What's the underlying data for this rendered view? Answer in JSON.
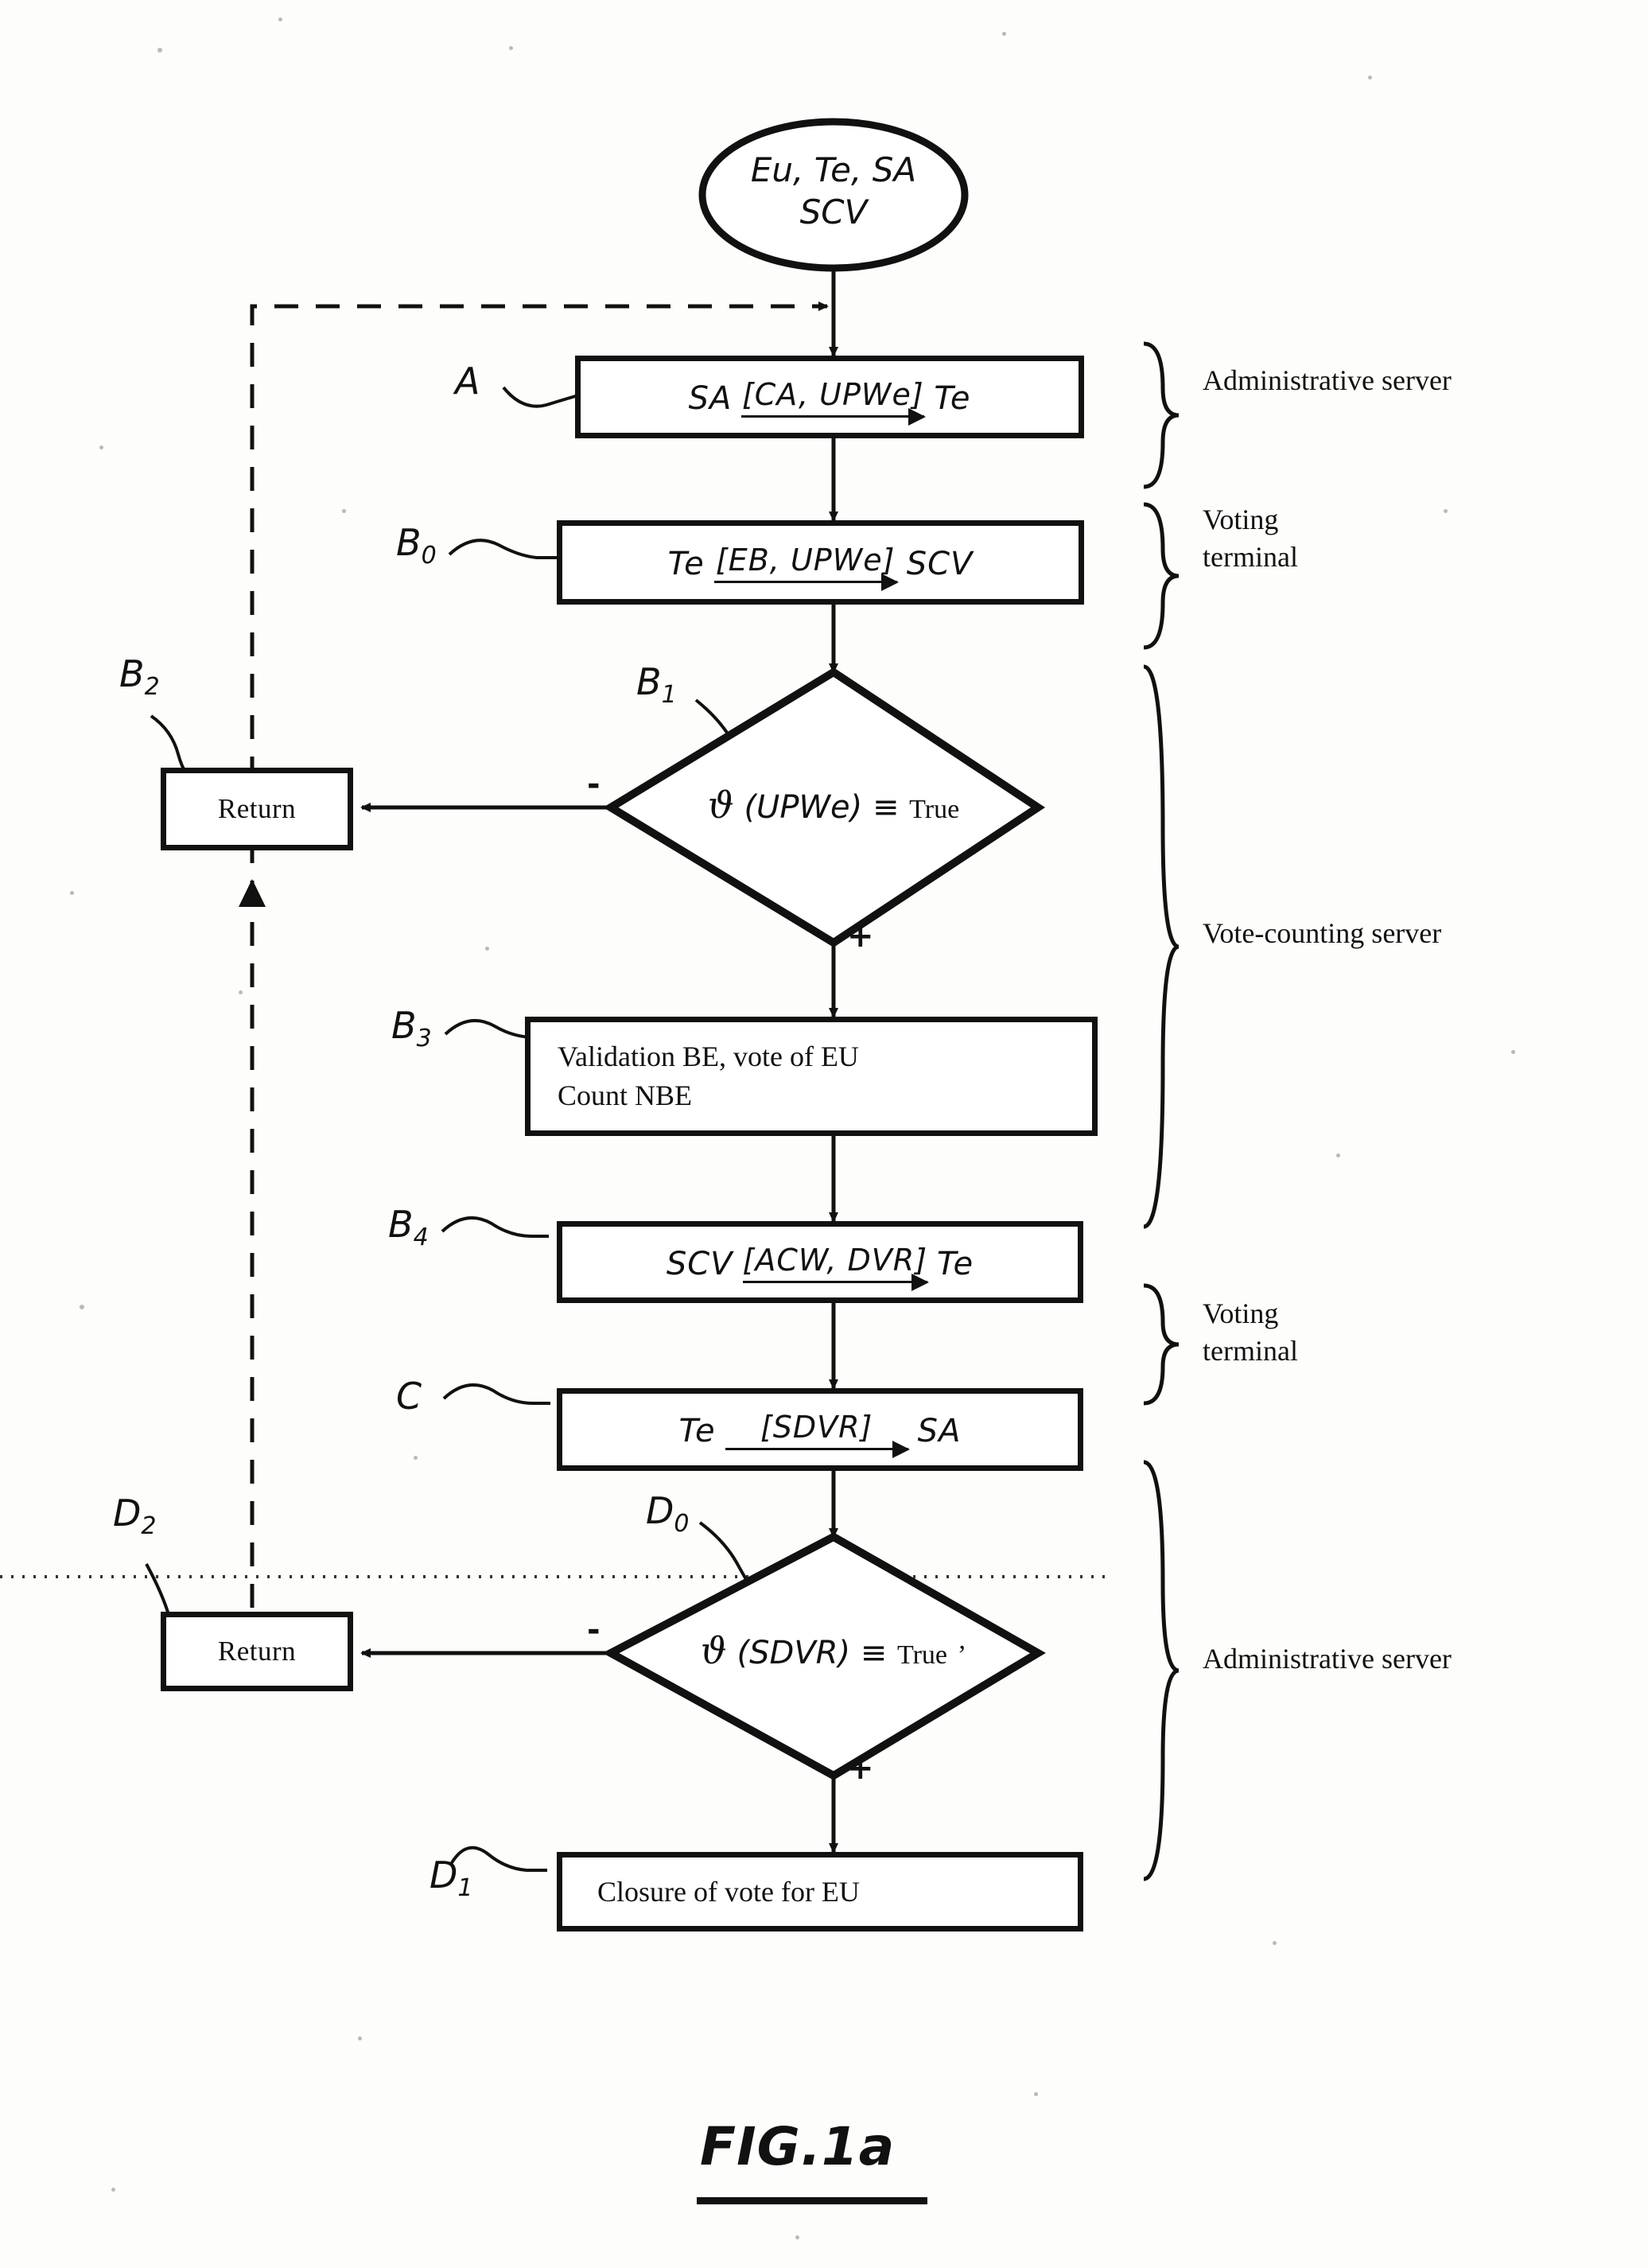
{
  "figure": {
    "caption": "FIG.1a"
  },
  "start": {
    "line1": "Eu, Te, SA",
    "line2": "SCV"
  },
  "steps": {
    "a": {
      "ref": "A",
      "ref_sub": "",
      "from": "SA",
      "payload": "[CA, UPWe]",
      "to": "Te"
    },
    "b0": {
      "ref": "B",
      "ref_sub": "0",
      "from": "Te",
      "payload": "[EB, UPWe]",
      "to": "SCV"
    },
    "b1": {
      "ref": "B",
      "ref_sub": "1",
      "symbol": "ϑ",
      "condition": "(UPWe)",
      "equiv": "≡",
      "value": "True",
      "true_branch": "+",
      "false_branch": "-"
    },
    "b2": {
      "ref": "B",
      "ref_sub": "2",
      "label": "Return"
    },
    "b3": {
      "ref": "B",
      "ref_sub": "3",
      "line1": "Validation BE, vote of EU",
      "line2": "Count NBE"
    },
    "b4": {
      "ref": "B",
      "ref_sub": "4",
      "from": "SCV",
      "payload": "[ACW, DVR]",
      "to": "Te"
    },
    "c": {
      "ref": "C",
      "ref_sub": "",
      "from": "Te",
      "payload": "[SDVR]",
      "to": "SA"
    },
    "d0": {
      "ref": "D",
      "ref_sub": "0",
      "symbol": "ϑ",
      "condition": "(SDVR)",
      "equiv": "≡",
      "value": "True",
      "trailing": "’",
      "true_branch": "+",
      "false_branch": "-"
    },
    "d1": {
      "ref": "D",
      "ref_sub": "1",
      "label": "Closure of vote for EU"
    },
    "d2": {
      "ref": "D",
      "ref_sub": "2",
      "label": "Return"
    }
  },
  "annotations": [
    {
      "text": "Administrative server"
    },
    {
      "text_line1": "Voting",
      "text_line2": "terminal"
    },
    {
      "text": "Vote-counting server"
    },
    {
      "text_line1": "Voting",
      "text_line2": "terminal"
    },
    {
      "text": "Administrative server"
    }
  ],
  "colors": {
    "ink": "#111111",
    "paper": "#fdfdfb"
  }
}
